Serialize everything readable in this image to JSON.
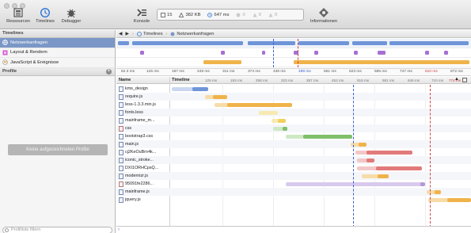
{
  "toolbar": {
    "buttons": [
      {
        "label": "Ressourcen",
        "icon": "resources-icon"
      },
      {
        "label": "Timelines",
        "icon": "timelines-icon"
      },
      {
        "label": "Debugger",
        "icon": "debugger-icon"
      },
      {
        "label": "Konsole",
        "icon": "console-icon"
      },
      {
        "label": "Informationen",
        "icon": "information-icon"
      }
    ],
    "status": {
      "requests": "15",
      "size": "382 KB",
      "time": "647 ms",
      "errors": "0",
      "warnings": "0",
      "logs": "0"
    }
  },
  "sidebar": {
    "timelines_header": "Timelines",
    "timeline_items": [
      {
        "label": "Netzwerkanfragen",
        "selected": true
      },
      {
        "label": "Layout & Rendern",
        "selected": false
      },
      {
        "label": "JavaScript & Ereignisse",
        "selected": false
      }
    ],
    "profile_header": "Profile",
    "empty_profile_button": "Keine aufgezeichneten Profile",
    "filter_placeholder": "Profilliste filtern"
  },
  "main": {
    "breadcrumb": [
      "Timelines",
      "Netzwerkanfragen"
    ],
    "ruler_ticks": [
      "62.3 ms",
      "125 ms",
      "187 ms",
      "249 ms",
      "311 ms",
      "374 ms",
      "436 ms",
      "498 ms",
      "561 ms",
      "623 ms",
      "685 ms",
      "747 ms",
      "810 ms",
      "872 ms"
    ],
    "table_header": {
      "name": "Name",
      "timeline": "Timeline"
    },
    "header_ticks": [
      "129 ms",
      "193 ms",
      "258 ms",
      "323 ms",
      "387 ms",
      "452 ms",
      "516 ms",
      "581 ms",
      "646 ms",
      "710 ms",
      "774 ms"
    ],
    "rows": [
      {
        "name": "kms_design",
        "type": "doc"
      },
      {
        "name": "require.js",
        "type": "script"
      },
      {
        "name": "less-1.3.3.min.js",
        "type": "script"
      },
      {
        "name": "fonts.less",
        "type": "doc"
      },
      {
        "name": "mainframe_m...",
        "type": "doc"
      },
      {
        "name": "css",
        "type": "img"
      },
      {
        "name": "bootstrap3.css",
        "type": "doc"
      },
      {
        "name": "main.js",
        "type": "script"
      },
      {
        "name": "cj2KeOuBrn4k...",
        "type": "doc"
      },
      {
        "name": "iconic_stroke...",
        "type": "doc"
      },
      {
        "name": "DXI1ORHCpsQ...",
        "type": "doc"
      },
      {
        "name": "modernizr.js",
        "type": "script"
      },
      {
        "name": "95091fe2286...",
        "type": "img"
      },
      {
        "name": "mainframe.js",
        "type": "script"
      },
      {
        "name": "jquery.js",
        "type": "script"
      }
    ],
    "console_prompt": "›"
  },
  "colors": {
    "document": "#6f95d8",
    "script": "#f0b34a",
    "stylesheet": "#7fc06a",
    "font": "#e27a7a",
    "other": "#b49ad8",
    "layout": "#a76fd4",
    "selection": "#7b97c7"
  }
}
